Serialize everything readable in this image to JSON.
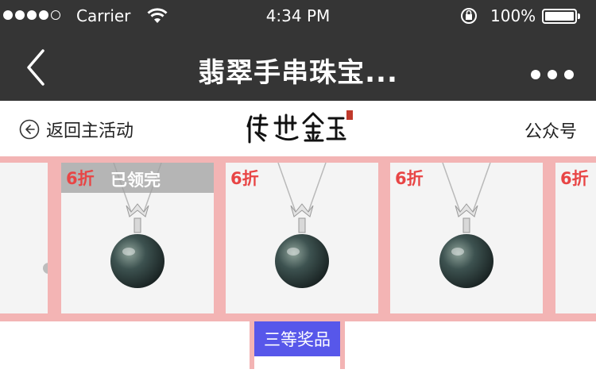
{
  "status_bar": {
    "carrier": "Carrier",
    "time": "4:34 PM",
    "battery": "100%"
  },
  "nav": {
    "title": "翡翠手串珠宝...",
    "back_icon": "chevron-left-icon",
    "more_icon": "ellipsis-icon"
  },
  "sub_header": {
    "back_label": "返回主活动",
    "logo_text": "传世金玉",
    "right_label": "公众号"
  },
  "carousel": {
    "background": "#f3b4b4",
    "cards": [
      {
        "discount": "",
        "status": ""
      },
      {
        "discount": "6折",
        "status": "已领完"
      },
      {
        "discount": "6折",
        "status": ""
      },
      {
        "discount": "6折",
        "status": ""
      },
      {
        "discount": "6折",
        "status": ""
      }
    ]
  },
  "prize": {
    "label": "三等奖品",
    "color": "#5757ea"
  }
}
